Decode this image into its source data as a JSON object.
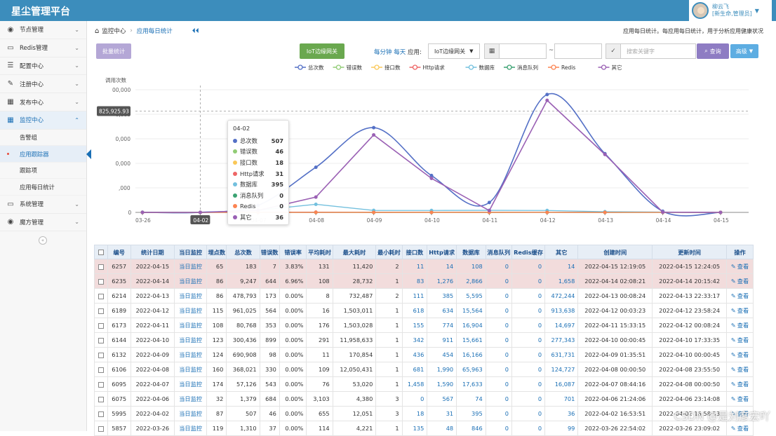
{
  "brand": "星尘管理平台",
  "user": {
    "name": "柳云飞",
    "role": "[新生命,管理员]"
  },
  "sidebar": {
    "items": [
      {
        "label": "节点管理",
        "icon": "dashboard-icon",
        "expanded": false
      },
      {
        "label": "Redis管理",
        "icon": "monitor-icon",
        "expanded": false
      },
      {
        "label": "配置中心",
        "icon": "list-icon",
        "expanded": false
      },
      {
        "label": "注册中心",
        "icon": "edit-icon",
        "expanded": false
      },
      {
        "label": "发布中心",
        "icon": "calendar-icon",
        "expanded": false
      },
      {
        "label": "监控中心",
        "icon": "calendar-icon",
        "expanded": true
      }
    ],
    "subitems": [
      "告警组",
      "应用跟踪器",
      "跟踪项",
      "应用每日统计"
    ],
    "items2": [
      {
        "label": "系统管理",
        "icon": "monitor-icon"
      },
      {
        "label": "魔方管理",
        "icon": "dashboard-icon"
      }
    ]
  },
  "breadcrumb": {
    "root": "监控中心",
    "current": "应用每日统计"
  },
  "page_desc": "应用每日统计。每应用每日统计，用于分析应用健康状况",
  "toolbar": {
    "bulk": "批量统计",
    "gateway": "IoT边缘网关",
    "period": "每分钟 每天",
    "app_label": "应用:",
    "app_value": "IoT边缘网关",
    "range_sep": "~",
    "search_placeholder": "搜索关键字",
    "query": "查询",
    "advanced": "高级"
  },
  "chart_data": {
    "type": "line",
    "ylabel": "调用次数",
    "yticks": [
      "0",
      ",000",
      "0,000",
      "0,000",
      "0,000",
      "00,000"
    ],
    "ylim": [
      0,
      1000000
    ],
    "crosshair_label": "825,925.93",
    "crosshair_value": 825925.93,
    "categories": [
      "03-26",
      "04-02",
      "04-07",
      "04-08",
      "04-09",
      "04-10",
      "04-11",
      "04-12",
      "04-13",
      "04-14",
      "04-15"
    ],
    "series": [
      {
        "name": "总次数",
        "color": "#5470c6",
        "values": [
          1310,
          507,
          57126,
          368021,
          690908,
          300436,
          80768,
          961025,
          478793,
          9247,
          183
        ]
      },
      {
        "name": "错误数",
        "color": "#91cc75",
        "values": [
          37,
          46,
          543,
          330,
          98,
          899,
          353,
          564,
          173,
          644,
          7
        ]
      },
      {
        "name": "接口数",
        "color": "#fac858",
        "values": [
          135,
          18,
          1458,
          681,
          436,
          342,
          155,
          618,
          111,
          83,
          11
        ]
      },
      {
        "name": "Http请求",
        "color": "#ee6666",
        "values": [
          48,
          31,
          1590,
          1990,
          454,
          911,
          774,
          634,
          385,
          1276,
          14
        ]
      },
      {
        "name": "数据库",
        "color": "#73c0de",
        "values": [
          846,
          395,
          17633,
          65963,
          16166,
          15661,
          16904,
          15564,
          5595,
          2866,
          108
        ]
      },
      {
        "name": "消息队列",
        "color": "#3ba272",
        "values": [
          0,
          0,
          0,
          0,
          0,
          0,
          0,
          0,
          0,
          0,
          0
        ]
      },
      {
        "name": "Redis",
        "color": "#fc8452",
        "values": [
          0,
          0,
          0,
          0,
          0,
          0,
          0,
          0,
          0,
          0,
          0
        ]
      },
      {
        "name": "其它",
        "color": "#9a60b4",
        "values": [
          99,
          36,
          16087,
          124727,
          631731,
          277343,
          14697,
          913638,
          472244,
          1658,
          14
        ]
      }
    ],
    "highlight_category": "04-02",
    "legend": "top-center"
  },
  "tooltip": {
    "title": "04-02",
    "rows": [
      {
        "name": "总次数",
        "value": "507",
        "color": "#5470c6"
      },
      {
        "name": "错误数",
        "value": "46",
        "color": "#91cc75"
      },
      {
        "name": "接口数",
        "value": "18",
        "color": "#fac858"
      },
      {
        "name": "Http请求",
        "value": "31",
        "color": "#ee6666"
      },
      {
        "name": "数据库",
        "value": "395",
        "color": "#73c0de"
      },
      {
        "name": "消息队列",
        "value": "0",
        "color": "#3ba272"
      },
      {
        "name": "Redis",
        "value": "0",
        "color": "#fc8452"
      },
      {
        "name": "其它",
        "value": "36",
        "color": "#9a60b4"
      }
    ]
  },
  "table": {
    "headers": [
      "编号",
      "统计日期",
      "当日监控",
      "埋点数",
      "总次数",
      "错误数",
      "错误率",
      "平均耗时",
      "最大耗时",
      "最小耗时",
      "接口数",
      "Http请求",
      "数据库",
      "消息队列",
      "Redis缓存",
      "其它",
      "创建时间",
      "更新时间",
      "操作"
    ],
    "rows": [
      {
        "hl": true,
        "cells": [
          "6257",
          "2022-04-15",
          "当日监控",
          "65",
          "183",
          "7",
          "3.83%",
          "131",
          "11,420",
          "2",
          "11",
          "14",
          "108",
          "0",
          "0",
          "14",
          "2022-04-15 12:19:05",
          "2022-04-15 12:24:05",
          "查看"
        ]
      },
      {
        "hl": true,
        "cells": [
          "6235",
          "2022-04-14",
          "当日监控",
          "86",
          "9,247",
          "644",
          "6.96%",
          "108",
          "28,732",
          "1",
          "83",
          "1,276",
          "2,866",
          "0",
          "0",
          "1,658",
          "2022-04-14 02:08:21",
          "2022-04-14 20:15:42",
          "查看"
        ]
      },
      {
        "hl": false,
        "cells": [
          "6214",
          "2022-04-13",
          "当日监控",
          "86",
          "478,793",
          "173",
          "0.00%",
          "8",
          "732,487",
          "2",
          "111",
          "385",
          "5,595",
          "0",
          "0",
          "472,244",
          "2022-04-13 00:08:24",
          "2022-04-13 22:33:17",
          "查看"
        ]
      },
      {
        "hl": false,
        "cells": [
          "6189",
          "2022-04-12",
          "当日监控",
          "115",
          "961,025",
          "564",
          "0.00%",
          "16",
          "1,503,011",
          "1",
          "618",
          "634",
          "15,564",
          "0",
          "0",
          "913,638",
          "2022-04-12 00:03:23",
          "2022-04-12 23:58:24",
          "查看"
        ]
      },
      {
        "hl": false,
        "cells": [
          "6173",
          "2022-04-11",
          "当日监控",
          "108",
          "80,768",
          "353",
          "0.00%",
          "176",
          "1,503,028",
          "1",
          "155",
          "774",
          "16,904",
          "0",
          "0",
          "14,697",
          "2022-04-11 15:33:15",
          "2022-04-12 00:08:24",
          "查看"
        ]
      },
      {
        "hl": false,
        "cells": [
          "6144",
          "2022-04-10",
          "当日监控",
          "123",
          "300,436",
          "899",
          "0.00%",
          "291",
          "11,958,633",
          "1",
          "342",
          "911",
          "15,661",
          "0",
          "0",
          "277,343",
          "2022-04-10 00:00:45",
          "2022-04-10 17:33:35",
          "查看"
        ]
      },
      {
        "hl": false,
        "cells": [
          "6132",
          "2022-04-09",
          "当日监控",
          "124",
          "690,908",
          "98",
          "0.00%",
          "11",
          "170,854",
          "1",
          "436",
          "454",
          "16,166",
          "0",
          "0",
          "631,731",
          "2022-04-09 01:35:51",
          "2022-04-10 00:00:45",
          "查看"
        ]
      },
      {
        "hl": false,
        "cells": [
          "6106",
          "2022-04-08",
          "当日监控",
          "160",
          "368,021",
          "330",
          "0.00%",
          "109",
          "12,050,431",
          "1",
          "681",
          "1,990",
          "65,963",
          "0",
          "0",
          "124,727",
          "2022-04-08 00:00:50",
          "2022-04-08 23:55:50",
          "查看"
        ]
      },
      {
        "hl": false,
        "cells": [
          "6095",
          "2022-04-07",
          "当日监控",
          "174",
          "57,126",
          "543",
          "0.00%",
          "76",
          "53,020",
          "1",
          "1,458",
          "1,590",
          "17,633",
          "0",
          "0",
          "16,087",
          "2022-04-07 08:44:16",
          "2022-04-08 00:00:50",
          "查看"
        ]
      },
      {
        "hl": false,
        "cells": [
          "6075",
          "2022-04-06",
          "当日监控",
          "32",
          "1,379",
          "684",
          "0.00%",
          "3,103",
          "4,380",
          "3",
          "0",
          "567",
          "74",
          "0",
          "0",
          "701",
          "2022-04-06 21:24:06",
          "2022-04-06 23:14:08",
          "查看"
        ]
      },
      {
        "hl": false,
        "cells": [
          "5995",
          "2022-04-02",
          "当日监控",
          "87",
          "507",
          "46",
          "0.00%",
          "655",
          "12,051",
          "3",
          "18",
          "31",
          "395",
          "0",
          "0",
          "36",
          "2022-04-02 16:53:51",
          "2022-04-02 16:58:53",
          "查看"
        ]
      },
      {
        "hl": false,
        "cells": [
          "5857",
          "2022-03-26",
          "当日监控",
          "119",
          "1,310",
          "37",
          "0.00%",
          "114",
          "4,221",
          "1",
          "135",
          "48",
          "846",
          "0",
          "0",
          "99",
          "2022-03-26 22:54:02",
          "2022-03-26 23:09:02",
          "查看"
        ]
      }
    ]
  },
  "watermark": "CSDN @是刘彦宏吖"
}
